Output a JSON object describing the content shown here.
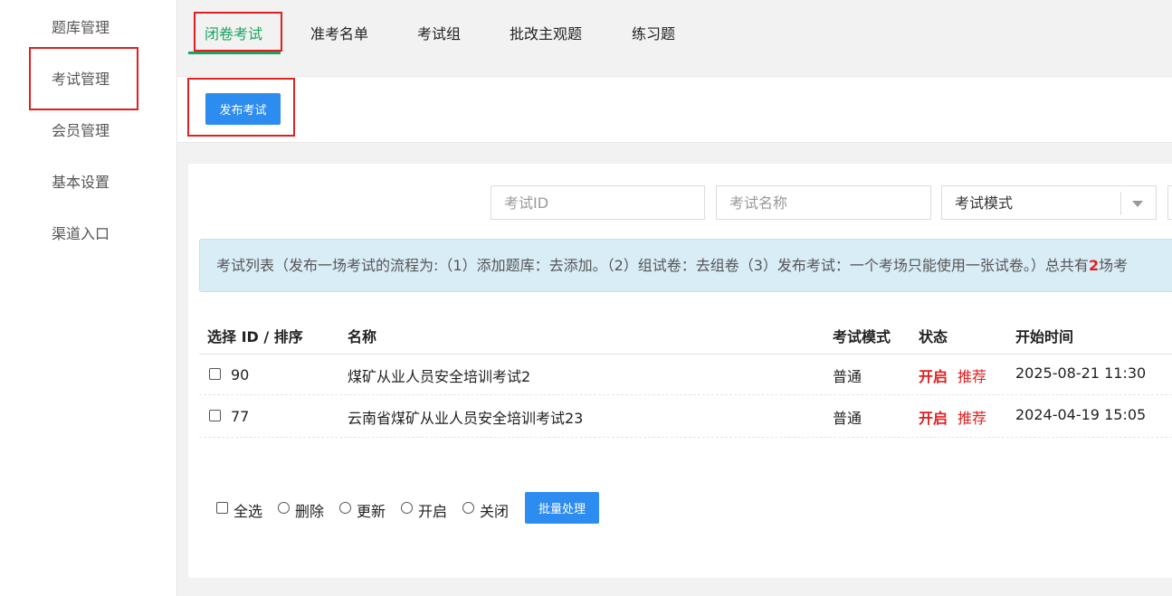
{
  "sidebar": {
    "items": [
      {
        "label": "题库管理"
      },
      {
        "label": "考试管理"
      },
      {
        "label": "会员管理"
      },
      {
        "label": "基本设置"
      },
      {
        "label": "渠道入口"
      }
    ]
  },
  "tabs": [
    {
      "label": "闭卷考试"
    },
    {
      "label": "准考名单"
    },
    {
      "label": "考试组"
    },
    {
      "label": "批改主观题"
    },
    {
      "label": "练习题"
    }
  ],
  "toolbar": {
    "publish_label": "发布考试"
  },
  "filters": {
    "exam_id_placeholder": "考试ID",
    "exam_name_placeholder": "考试名称",
    "mode_select_value": "考试模式"
  },
  "info": {
    "text_before": "考试列表（发布一场考试的流程为:（1）添加题库：去添加。（2）组试卷：去组卷（3）发布考试：一个考场只能使用一张试卷。）总共有",
    "count": "2",
    "text_after": "场考"
  },
  "table": {
    "headers": {
      "select_id": "选择 ID / 排序",
      "name": "名称",
      "mode": "考试模式",
      "status": "状态",
      "start_time": "开始时间"
    },
    "rows": [
      {
        "id": "90",
        "name": "煤矿从业人员安全培训考试2",
        "mode": "普通",
        "status": "开启",
        "recommend": "推荐",
        "start_time": "2025-08-21 11:30"
      },
      {
        "id": "77",
        "name": "云南省煤矿从业人员安全培训考试23",
        "mode": "普通",
        "status": "开启",
        "recommend": "推荐",
        "start_time": "2024-04-19 15:05"
      }
    ]
  },
  "bulk": {
    "select_all": "全选",
    "delete": "删除",
    "update": "更新",
    "open": "开启",
    "close": "关闭",
    "batch_button": "批量处理"
  },
  "colors": {
    "accent_green": "#1aa260",
    "primary_blue": "#2d8cf0",
    "highlight_red": "#e02020"
  }
}
